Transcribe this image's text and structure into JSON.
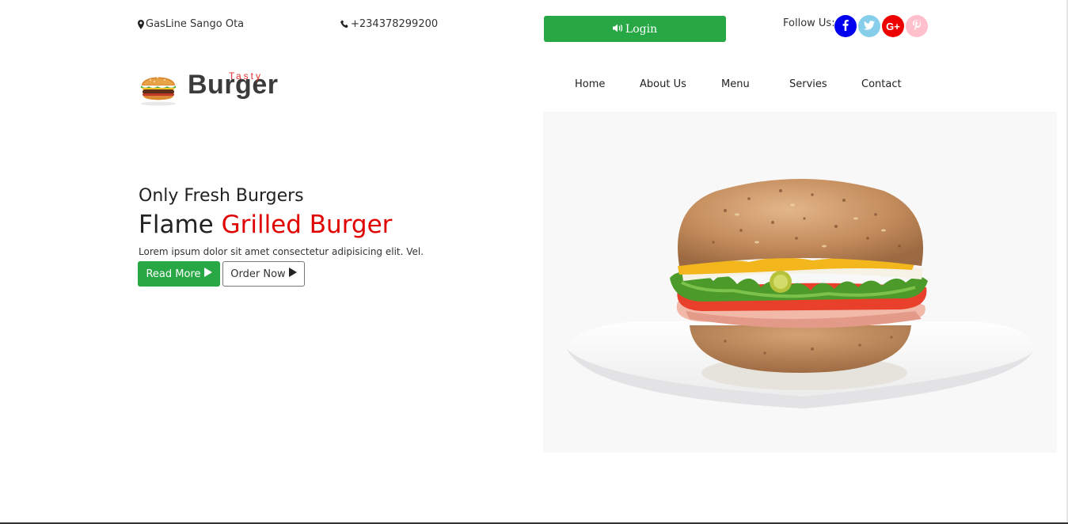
{
  "topbar": {
    "address": "GasLine Sango Ota",
    "phone": "+234378299200",
    "login_label": "Login",
    "follow_label": "Follow Us:",
    "social": [
      {
        "name": "facebook",
        "glyph": "f",
        "color": "#0000ee"
      },
      {
        "name": "twitter",
        "glyph": "t",
        "color": "#87ceeb"
      },
      {
        "name": "google-plus",
        "glyph": "G+",
        "color": "#ee0000"
      },
      {
        "name": "pinterest",
        "glyph": "p",
        "color": "#ffc0cb"
      }
    ]
  },
  "logo": {
    "word": "Burger",
    "tag": "Tasty"
  },
  "nav": {
    "items": [
      "Home",
      "About Us",
      "Menu",
      "Servies",
      "Contact"
    ]
  },
  "hero": {
    "subtitle": "Only Fresh Burgers",
    "title_plain": "Flame",
    "title_accent": "Grilled Burger",
    "text": "Lorem ipsum dolor sit amet consectetur adipisicing elit. Vel.",
    "read_more": "Read More",
    "order_now": "Order Now"
  },
  "colors": {
    "primary_green": "#28a745",
    "accent_red": "#e00000"
  }
}
